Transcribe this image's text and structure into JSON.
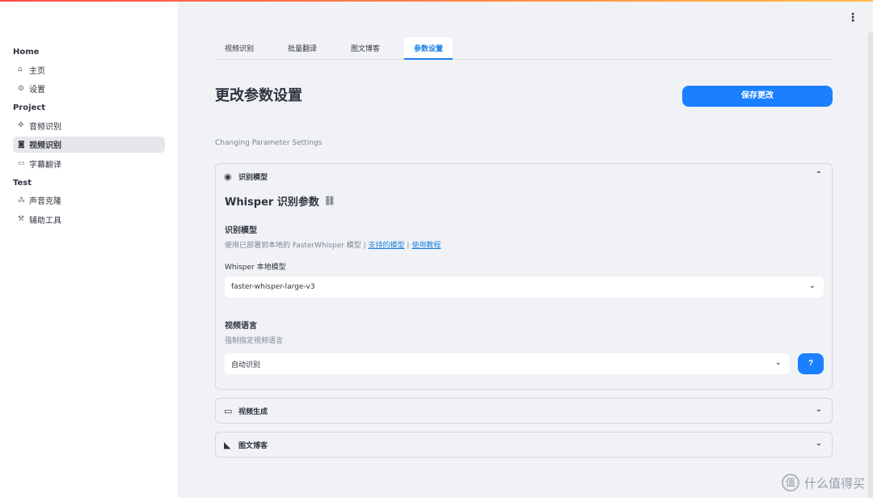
{
  "sidebar": {
    "sections": [
      {
        "title": "Home",
        "items": [
          {
            "label": "主页",
            "icon": "home-icon",
            "glyph": "⌂"
          },
          {
            "label": "设置",
            "icon": "gear-icon",
            "glyph": "⚙"
          }
        ]
      },
      {
        "title": "Project",
        "items": [
          {
            "label": "音频识别",
            "icon": "audio-icon",
            "glyph": "✜"
          },
          {
            "label": "视频识别",
            "icon": "video-icon",
            "glyph": "◙",
            "active": true
          },
          {
            "label": "字幕翻译",
            "icon": "subtitle-icon",
            "glyph": "▭"
          }
        ]
      },
      {
        "title": "Test",
        "items": [
          {
            "label": "声音克隆",
            "icon": "clone-icon",
            "glyph": "⁂"
          },
          {
            "label": "辅助工具",
            "icon": "tools-icon",
            "glyph": "⚒"
          }
        ]
      }
    ]
  },
  "tabs": [
    "视频识别",
    "批量翻译",
    "图文博客",
    "参数设置"
  ],
  "active_tab": 3,
  "page": {
    "title": "更改参数设置",
    "subtitle": "Changing Parameter Settings",
    "save_label": "保存更改"
  },
  "model_section": {
    "header": "识别模型",
    "heading": "Whisper 识别参数",
    "model_title": "识别模型",
    "model_caption_prefix": "使用已部署到本地的 FasterWhisper 模型 | ",
    "link_supported": "支持的模型",
    "link_sep": " | ",
    "link_tutorial": "使用教程",
    "local_model_label": "Whisper 本地模型",
    "local_model_value": "faster-whisper-large-v3",
    "lang_title": "视频语言",
    "lang_caption": "强制指定视频语言",
    "lang_value": "自动识别",
    "help_label": "?"
  },
  "video_section": {
    "header": "视频生成"
  },
  "blog_section": {
    "header": "图文博客"
  },
  "watermark": {
    "badge": "值",
    "text": "什么值得买"
  },
  "colors": {
    "accent": "#1a80ff",
    "link": "#1c83e1"
  }
}
